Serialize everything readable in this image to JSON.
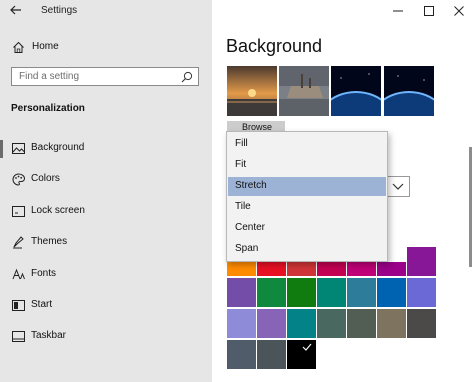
{
  "window": {
    "title": "Settings"
  },
  "sidebar": {
    "home_label": "Home",
    "search_placeholder": "Find a setting",
    "section_title": "Personalization",
    "items": [
      {
        "label": "Background",
        "icon": "picture-icon",
        "selected": true
      },
      {
        "label": "Colors",
        "icon": "palette-icon",
        "selected": false
      },
      {
        "label": "Lock screen",
        "icon": "lock-screen-icon",
        "selected": false
      },
      {
        "label": "Themes",
        "icon": "brush-icon",
        "selected": false
      },
      {
        "label": "Fonts",
        "icon": "font-icon",
        "selected": false
      },
      {
        "label": "Start",
        "icon": "start-icon",
        "selected": false
      },
      {
        "label": "Taskbar",
        "icon": "taskbar-icon",
        "selected": false
      }
    ]
  },
  "main": {
    "heading": "Background",
    "browse_label": "Browse",
    "recent_images": [
      "sunset-beach",
      "shipwreck",
      "earth-night-1",
      "earth-night-2"
    ],
    "fit_options": [
      "Fill",
      "Fit",
      "Stretch",
      "Tile",
      "Center",
      "Span"
    ],
    "fit_selected": "Stretch"
  },
  "colors": {
    "accent": "#0078d7",
    "selection_highlight": "#9db3d6",
    "swatches_row1": [
      "#ff8c00",
      "#e81123",
      "#d13438",
      "#c30052",
      "#bf0077",
      "#9a0089",
      "#881798"
    ],
    "swatches_row2": [
      "#744da9",
      "#10893e",
      "#107c10",
      "#018574",
      "#2d7d9a",
      "#0063b1",
      "#6b69d6"
    ],
    "swatches_row3": [
      "#8e8cd8",
      "#8764b8",
      "#038387",
      "#486860",
      "#525e54",
      "#7e735f",
      "#4c4a48"
    ],
    "swatches_row4": [
      "#515c6b",
      "#4a5459",
      "#000000"
    ]
  }
}
